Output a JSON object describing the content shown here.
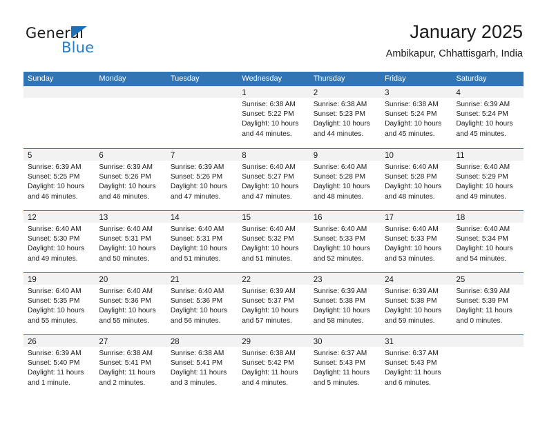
{
  "brand": {
    "name_part1": "General",
    "name_part2": "Blue",
    "triangle_color": "#1f6fb6",
    "blue_text_color": "#1f7fd0"
  },
  "header": {
    "title": "January 2025",
    "subtitle": "Ambikapur, Chhattisgarh, India"
  },
  "theme": {
    "header_blue": "#3175b5",
    "day_band_gray": "#f2f2f2",
    "text_color": "#1a1a1a"
  },
  "weekday_headers": [
    "Sunday",
    "Monday",
    "Tuesday",
    "Wednesday",
    "Thursday",
    "Friday",
    "Saturday"
  ],
  "weeks": [
    {
      "days": [
        {
          "num": "",
          "lines": []
        },
        {
          "num": "",
          "lines": []
        },
        {
          "num": "",
          "lines": []
        },
        {
          "num": "1",
          "lines": [
            "Sunrise: 6:38 AM",
            "Sunset: 5:22 PM",
            "Daylight: 10 hours",
            "and 44 minutes."
          ]
        },
        {
          "num": "2",
          "lines": [
            "Sunrise: 6:38 AM",
            "Sunset: 5:23 PM",
            "Daylight: 10 hours",
            "and 44 minutes."
          ]
        },
        {
          "num": "3",
          "lines": [
            "Sunrise: 6:38 AM",
            "Sunset: 5:24 PM",
            "Daylight: 10 hours",
            "and 45 minutes."
          ]
        },
        {
          "num": "4",
          "lines": [
            "Sunrise: 6:39 AM",
            "Sunset: 5:24 PM",
            "Daylight: 10 hours",
            "and 45 minutes."
          ]
        }
      ]
    },
    {
      "days": [
        {
          "num": "5",
          "lines": [
            "Sunrise: 6:39 AM",
            "Sunset: 5:25 PM",
            "Daylight: 10 hours",
            "and 46 minutes."
          ]
        },
        {
          "num": "6",
          "lines": [
            "Sunrise: 6:39 AM",
            "Sunset: 5:26 PM",
            "Daylight: 10 hours",
            "and 46 minutes."
          ]
        },
        {
          "num": "7",
          "lines": [
            "Sunrise: 6:39 AM",
            "Sunset: 5:26 PM",
            "Daylight: 10 hours",
            "and 47 minutes."
          ]
        },
        {
          "num": "8",
          "lines": [
            "Sunrise: 6:40 AM",
            "Sunset: 5:27 PM",
            "Daylight: 10 hours",
            "and 47 minutes."
          ]
        },
        {
          "num": "9",
          "lines": [
            "Sunrise: 6:40 AM",
            "Sunset: 5:28 PM",
            "Daylight: 10 hours",
            "and 48 minutes."
          ]
        },
        {
          "num": "10",
          "lines": [
            "Sunrise: 6:40 AM",
            "Sunset: 5:28 PM",
            "Daylight: 10 hours",
            "and 48 minutes."
          ]
        },
        {
          "num": "11",
          "lines": [
            "Sunrise: 6:40 AM",
            "Sunset: 5:29 PM",
            "Daylight: 10 hours",
            "and 49 minutes."
          ]
        }
      ]
    },
    {
      "days": [
        {
          "num": "12",
          "lines": [
            "Sunrise: 6:40 AM",
            "Sunset: 5:30 PM",
            "Daylight: 10 hours",
            "and 49 minutes."
          ]
        },
        {
          "num": "13",
          "lines": [
            "Sunrise: 6:40 AM",
            "Sunset: 5:31 PM",
            "Daylight: 10 hours",
            "and 50 minutes."
          ]
        },
        {
          "num": "14",
          "lines": [
            "Sunrise: 6:40 AM",
            "Sunset: 5:31 PM",
            "Daylight: 10 hours",
            "and 51 minutes."
          ]
        },
        {
          "num": "15",
          "lines": [
            "Sunrise: 6:40 AM",
            "Sunset: 5:32 PM",
            "Daylight: 10 hours",
            "and 51 minutes."
          ]
        },
        {
          "num": "16",
          "lines": [
            "Sunrise: 6:40 AM",
            "Sunset: 5:33 PM",
            "Daylight: 10 hours",
            "and 52 minutes."
          ]
        },
        {
          "num": "17",
          "lines": [
            "Sunrise: 6:40 AM",
            "Sunset: 5:33 PM",
            "Daylight: 10 hours",
            "and 53 minutes."
          ]
        },
        {
          "num": "18",
          "lines": [
            "Sunrise: 6:40 AM",
            "Sunset: 5:34 PM",
            "Daylight: 10 hours",
            "and 54 minutes."
          ]
        }
      ]
    },
    {
      "days": [
        {
          "num": "19",
          "lines": [
            "Sunrise: 6:40 AM",
            "Sunset: 5:35 PM",
            "Daylight: 10 hours",
            "and 55 minutes."
          ]
        },
        {
          "num": "20",
          "lines": [
            "Sunrise: 6:40 AM",
            "Sunset: 5:36 PM",
            "Daylight: 10 hours",
            "and 55 minutes."
          ]
        },
        {
          "num": "21",
          "lines": [
            "Sunrise: 6:40 AM",
            "Sunset: 5:36 PM",
            "Daylight: 10 hours",
            "and 56 minutes."
          ]
        },
        {
          "num": "22",
          "lines": [
            "Sunrise: 6:39 AM",
            "Sunset: 5:37 PM",
            "Daylight: 10 hours",
            "and 57 minutes."
          ]
        },
        {
          "num": "23",
          "lines": [
            "Sunrise: 6:39 AM",
            "Sunset: 5:38 PM",
            "Daylight: 10 hours",
            "and 58 minutes."
          ]
        },
        {
          "num": "24",
          "lines": [
            "Sunrise: 6:39 AM",
            "Sunset: 5:38 PM",
            "Daylight: 10 hours",
            "and 59 minutes."
          ]
        },
        {
          "num": "25",
          "lines": [
            "Sunrise: 6:39 AM",
            "Sunset: 5:39 PM",
            "Daylight: 11 hours",
            "and 0 minutes."
          ]
        }
      ]
    },
    {
      "days": [
        {
          "num": "26",
          "lines": [
            "Sunrise: 6:39 AM",
            "Sunset: 5:40 PM",
            "Daylight: 11 hours",
            "and 1 minute."
          ]
        },
        {
          "num": "27",
          "lines": [
            "Sunrise: 6:38 AM",
            "Sunset: 5:41 PM",
            "Daylight: 11 hours",
            "and 2 minutes."
          ]
        },
        {
          "num": "28",
          "lines": [
            "Sunrise: 6:38 AM",
            "Sunset: 5:41 PM",
            "Daylight: 11 hours",
            "and 3 minutes."
          ]
        },
        {
          "num": "29",
          "lines": [
            "Sunrise: 6:38 AM",
            "Sunset: 5:42 PM",
            "Daylight: 11 hours",
            "and 4 minutes."
          ]
        },
        {
          "num": "30",
          "lines": [
            "Sunrise: 6:37 AM",
            "Sunset: 5:43 PM",
            "Daylight: 11 hours",
            "and 5 minutes."
          ]
        },
        {
          "num": "31",
          "lines": [
            "Sunrise: 6:37 AM",
            "Sunset: 5:43 PM",
            "Daylight: 11 hours",
            "and 6 minutes."
          ]
        },
        {
          "num": "",
          "lines": []
        }
      ]
    }
  ]
}
